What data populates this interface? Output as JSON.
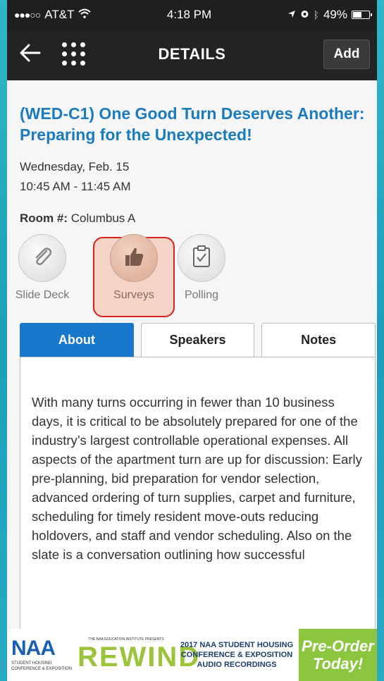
{
  "status_bar": {
    "carrier": "AT&T",
    "signal": "●●●○○",
    "wifi_icon": "wifi-icon",
    "time": "4:18 PM",
    "battery_percent": "49%",
    "battery_level": 0.49
  },
  "nav": {
    "title": "DETAILS",
    "add_label": "Add",
    "back_icon": "back-arrow-icon",
    "menu_icon": "grid-menu-icon"
  },
  "session": {
    "title": "(WED-C1) One Good Turn Deserves Another: Preparing for the Unexpected!",
    "date": "Wednesday, Feb. 15",
    "time": "10:45 AM - 11:45 AM",
    "room_label": "Room #:",
    "room_value": "Columbus A"
  },
  "actions": [
    {
      "label": "Slide Deck",
      "icon": "paperclip-icon"
    },
    {
      "label": "Surveys",
      "icon": "thumbs-up-icon"
    },
    {
      "label": "Polling",
      "icon": "clipboard-check-icon"
    }
  ],
  "tabs": [
    {
      "label": "About",
      "active": true
    },
    {
      "label": "Speakers",
      "active": false
    },
    {
      "label": "Notes",
      "active": false
    }
  ],
  "about_text": "With many turns occurring in fewer than 10 business days, it is critical to be absolutely prepared for one of the industry’s largest controllable operational expenses. All aspects of the apartment turn are up for discussion: Early pre-planning, bid preparation for vendor selection, advanced ordering of turn supplies, carpet and furniture, scheduling for timely resident move-outs reducing holdovers, and staff and vendor scheduling. Also on the slate is a conversation outlining how successful",
  "ad": {
    "naa_logo": "NAA",
    "naa_sub": "STUDENT HOUSING CONFERENCE & EXPOSITION",
    "rewind_top": "THE NAA EDUCATION INSTITUTE PRESENTS",
    "rewind": "REWIND",
    "conf_line1": "2017 NAA STUDENT HOUSING",
    "conf_line2": "CONFERENCE & EXPOSITION",
    "conf_line3": "AUDIO RECORDINGS",
    "preorder_line1": "Pre-Order",
    "preorder_line2": "Today!"
  },
  "colors": {
    "accent": "#1877c9",
    "title_blue": "#1a7bbd",
    "highlight_red": "#d82020",
    "ad_green": "#8cc63f"
  }
}
